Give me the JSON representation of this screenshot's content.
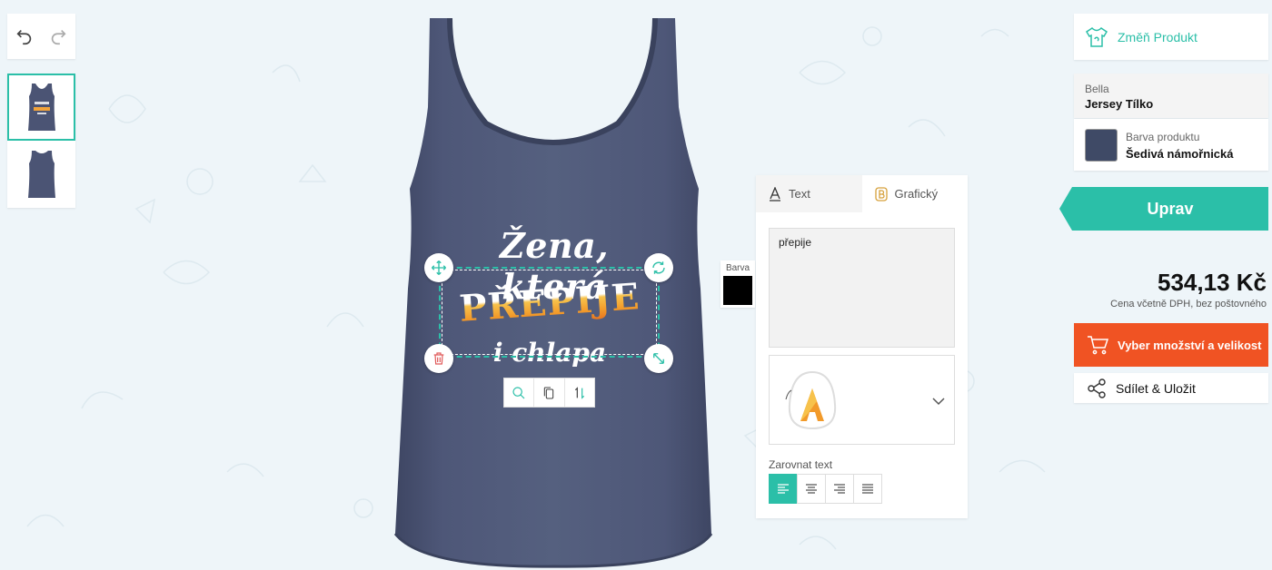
{
  "toolbar": {
    "undo_icon": "undo-icon",
    "redo_icon": "redo-icon"
  },
  "views": [
    {
      "name": "front",
      "active": true
    },
    {
      "name": "back",
      "active": false
    }
  ],
  "design": {
    "line1": "Žena, která",
    "line2": "PŘEPIJE",
    "line3": "i chlapa",
    "text_color": "#ffffff",
    "accent_gradient": [
      "#f7c24b",
      "#e8711e"
    ]
  },
  "selection": {
    "handles": [
      "move-icon",
      "rotate-icon",
      "delete-icon",
      "scale-icon"
    ],
    "tools": [
      "zoom-icon",
      "duplicate-icon",
      "vertical-flip-icon"
    ]
  },
  "barva": {
    "label": "Barva",
    "color": "#000000"
  },
  "editor": {
    "tabs": [
      {
        "label": "Text",
        "active": true
      },
      {
        "label": "Grafický",
        "active": false
      }
    ],
    "text_value": "přepije",
    "align_label": "Zarovnat text",
    "align_options": [
      "left",
      "center",
      "right",
      "justify"
    ],
    "align_selected": "left"
  },
  "sidebar": {
    "change_product": "Změň Produkt",
    "brand": "Bella",
    "product_name": "Jersey Tílko",
    "color_label": "Barva produktu",
    "color_value": "Šedivá námořnická",
    "color_hex": "#3f4a66",
    "edit_button": "Uprav",
    "price": "534,13 Kč",
    "price_note": "Cena včetně DPH, bez poštovného",
    "buy_button": "Vyber množství a velikost",
    "share_button": "Sdílet & Uložit"
  },
  "colors": {
    "accent": "#2bbfa8",
    "buy": "#f05323",
    "shirt": "#4b5474"
  }
}
